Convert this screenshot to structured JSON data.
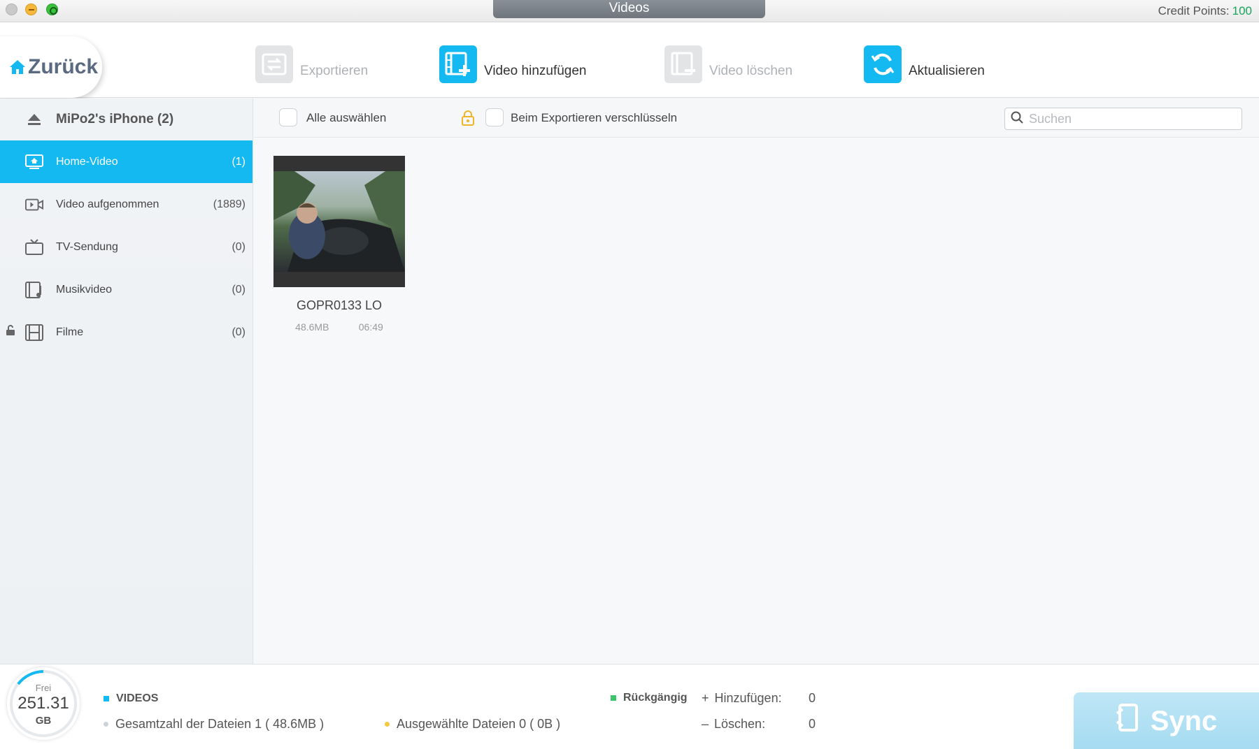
{
  "window": {
    "title": "Videos",
    "credit_label": "Credit Points:",
    "credit_value": "100"
  },
  "toolbar": {
    "back_label": "Zurück",
    "export_label": "Exportieren",
    "add_label": "Video hinzufügen",
    "delete_label": "Video löschen",
    "refresh_label": "Aktualisieren"
  },
  "sidebar": {
    "device": "MiPo2's iPhone (2)",
    "items": [
      {
        "label": "Home-Video",
        "count": "(1)"
      },
      {
        "label": "Video aufgenommen",
        "count": "(1889)"
      },
      {
        "label": "TV-Sendung",
        "count": "(0)"
      },
      {
        "label": "Musikvideo",
        "count": "(0)"
      },
      {
        "label": "Filme",
        "count": "(0)"
      }
    ]
  },
  "filter": {
    "select_all": "Alle auswählen",
    "encrypt": "Beim Exportieren verschlüsseln",
    "search_placeholder": "Suchen"
  },
  "videos": [
    {
      "name": "GOPR0133 LO",
      "size": "48.6MB",
      "duration": "06:49"
    }
  ],
  "status": {
    "free_label": "Frei",
    "free_value": "251.31",
    "free_unit": "GB",
    "section": "VIDEOS",
    "total_files": "Gesamtzahl der Dateien 1 ( 48.6MB )",
    "selected_files": "Ausgewählte Dateien 0 ( 0B )",
    "undo": "Rückgängig",
    "add_label": "Hinzufügen:",
    "add_value": "0",
    "delete_label": "Löschen:",
    "delete_value": "0",
    "sync_label": "Sync"
  },
  "colors": {
    "accent": "#13b9f0",
    "credit": "#19a35a"
  }
}
